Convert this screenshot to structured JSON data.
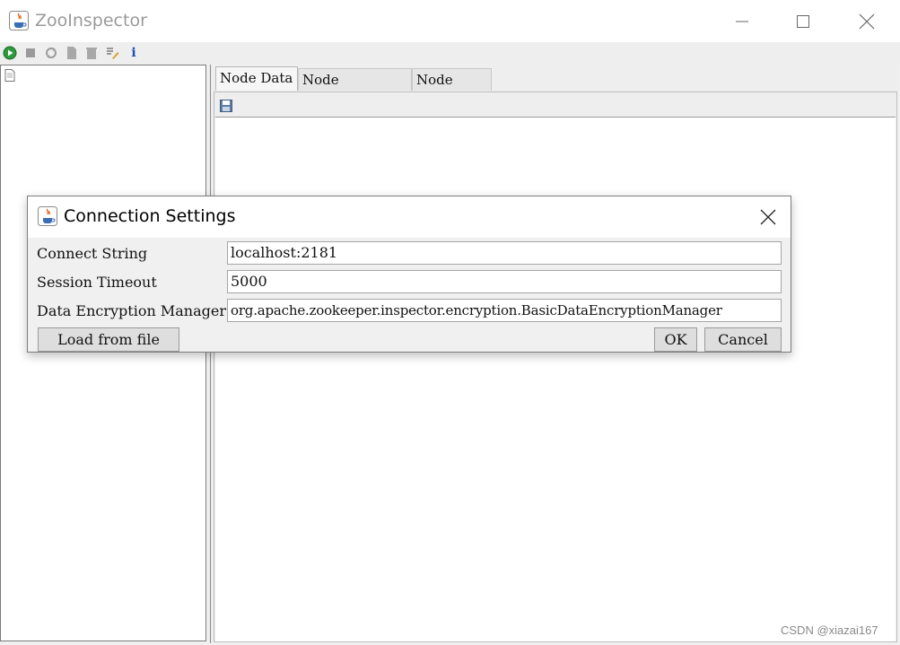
{
  "window": {
    "title": "ZooInspector",
    "controls": {
      "minimize_icon": "minimize-icon",
      "maximize_icon": "maximize-icon",
      "close_icon": "close-icon"
    }
  },
  "toolbar": {
    "icons": [
      "connect-icon",
      "disconnect-icon",
      "refresh-icon",
      "add-node-icon",
      "delete-node-icon",
      "edit-icon",
      "about-icon"
    ],
    "about_glyph": "i"
  },
  "tabs": [
    {
      "label": "Node Data",
      "active": true
    },
    {
      "label": "Node Metadata",
      "active": false
    },
    {
      "label": "Node ACLs",
      "active": false
    }
  ],
  "dialog": {
    "title": "Connection Settings",
    "fields": {
      "connect_string": {
        "label": "Connect String",
        "value": "localhost:2181"
      },
      "session_timeout": {
        "label": "Session Timeout",
        "value": "5000"
      },
      "data_encryption_manager": {
        "label": "Data Encryption Manager",
        "value": "org.apache.zookeeper.inspector.encryption.BasicDataEncryptionManager"
      }
    },
    "buttons": {
      "load": "Load from file",
      "ok": "OK",
      "cancel": "Cancel"
    }
  },
  "watermark": "CSDN @xiazai167",
  "colors": {
    "connect_green": "#2e9a3e",
    "about_blue": "#1f4fb0",
    "java_icon_orange": "#e06a1c"
  }
}
